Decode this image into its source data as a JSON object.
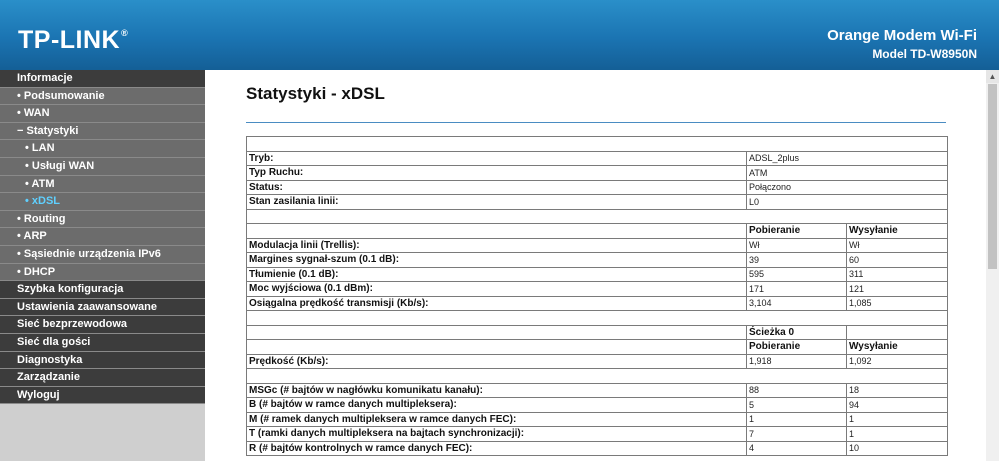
{
  "header": {
    "logo": "TP-LINK",
    "logo_mark": "®",
    "product": "Orange Modem Wi-Fi",
    "model": "Model TD-W8950N"
  },
  "sidebar": {
    "items": [
      {
        "label": "Informacje",
        "level": "top"
      },
      {
        "label": "• Podsumowanie",
        "level": "l1"
      },
      {
        "label": "• WAN",
        "level": "l1"
      },
      {
        "label": "− Statystyki",
        "level": "l1"
      },
      {
        "label": "• LAN",
        "level": "l2"
      },
      {
        "label": "• Usługi WAN",
        "level": "l2"
      },
      {
        "label": "• ATM",
        "level": "l2"
      },
      {
        "label": "• xDSL",
        "level": "l2",
        "active": true
      },
      {
        "label": "• Routing",
        "level": "l1"
      },
      {
        "label": "• ARP",
        "level": "l1"
      },
      {
        "label": "• Sąsiednie urządzenia IPv6",
        "level": "l1"
      },
      {
        "label": "• DHCP",
        "level": "l1"
      },
      {
        "label": "Szybka konfiguracja",
        "level": "top"
      },
      {
        "label": "Ustawienia zaawansowane",
        "level": "top"
      },
      {
        "label": "Sieć bezprzewodowa",
        "level": "top"
      },
      {
        "label": "Sieć dla gości",
        "level": "top"
      },
      {
        "label": "Diagnostyka",
        "level": "top"
      },
      {
        "label": "Zarządzanie",
        "level": "top"
      },
      {
        "label": "Wyloguj",
        "level": "top"
      }
    ]
  },
  "main": {
    "title": "Statystyki - xDSL",
    "rows": [
      {
        "type": "empty"
      },
      {
        "type": "data",
        "cells": [
          "Tryb:",
          "ADSL_2plus"
        ]
      },
      {
        "type": "data",
        "cells": [
          "Typ Ruchu:",
          "ATM"
        ]
      },
      {
        "type": "data",
        "cells": [
          "Status:",
          "Połączono"
        ]
      },
      {
        "type": "data",
        "cells": [
          "Stan zasilania linii:",
          "L0"
        ]
      },
      {
        "type": "empty"
      },
      {
        "type": "header",
        "cells": [
          "",
          "Pobieranie",
          "Wysyłanie"
        ]
      },
      {
        "type": "data",
        "cells": [
          "Modulacja linii (Trellis):",
          "Wł",
          "Wł"
        ]
      },
      {
        "type": "data",
        "cells": [
          "Margines sygnał-szum (0.1 dB):",
          "39",
          "60"
        ]
      },
      {
        "type": "data",
        "cells": [
          "Tłumienie (0.1 dB):",
          "595",
          "311"
        ]
      },
      {
        "type": "data",
        "cells": [
          "Moc wyjściowa (0.1 dBm):",
          "171",
          "121"
        ]
      },
      {
        "type": "data",
        "cells": [
          "Osiągalna prędkość transmisji (Kb/s):",
          "3,104",
          "1,085"
        ]
      },
      {
        "type": "empty"
      },
      {
        "type": "header",
        "cells": [
          "",
          "Ścieżka 0",
          ""
        ]
      },
      {
        "type": "header",
        "cells": [
          "",
          "Pobieranie",
          "Wysyłanie"
        ]
      },
      {
        "type": "data",
        "cells": [
          "Prędkość (Kb/s):",
          "1,918",
          "1,092"
        ]
      },
      {
        "type": "empty"
      },
      {
        "type": "data",
        "cells": [
          "MSGc (# bajtów w nagłówku komunikatu kanału):",
          "88",
          "18"
        ]
      },
      {
        "type": "data",
        "cells": [
          "B (# bajtów w ramce danych multipleksera):",
          "5",
          "94"
        ]
      },
      {
        "type": "data",
        "cells": [
          "M (# ramek danych multipleksera w ramce danych FEC):",
          "1",
          "1"
        ]
      },
      {
        "type": "data",
        "cells": [
          "T (ramki danych multipleksera na bajtach synchronizacji):",
          "7",
          "1"
        ]
      },
      {
        "type": "data",
        "cells": [
          "R (# bajtów kontrolnych w ramce danych FEC):",
          "4",
          "10"
        ]
      }
    ]
  },
  "scrollbar": {
    "up_arrow": "▲"
  }
}
